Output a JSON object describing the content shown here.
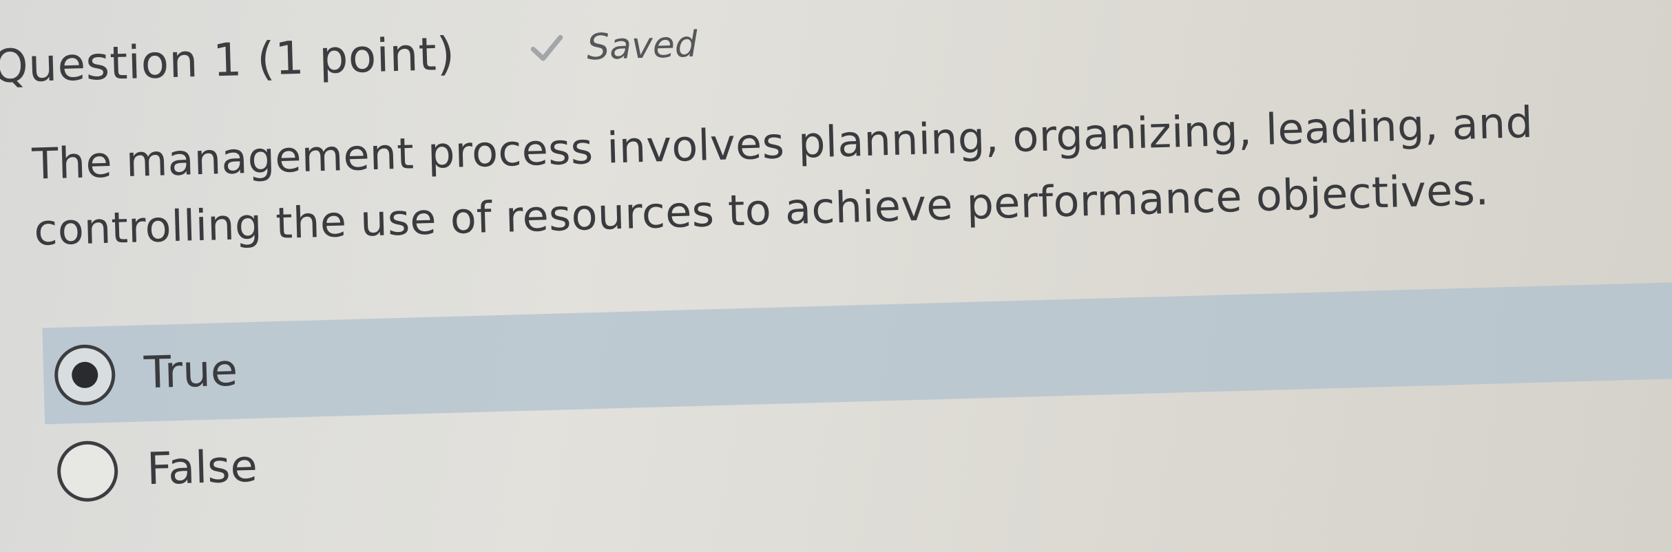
{
  "question": {
    "title": "Question 1 (1 point)",
    "status": "Saved",
    "status_icon": "check-icon",
    "text": "The management process involves planning, organizing, leading, and controlling the use of resources to achieve performance objectives."
  },
  "answers": [
    {
      "label": "True",
      "selected": true
    },
    {
      "label": "False",
      "selected": false
    }
  ],
  "colors": {
    "selected_row": "#b0c2cd",
    "text": "#3a3b3e",
    "check": "#9fa3a6"
  }
}
